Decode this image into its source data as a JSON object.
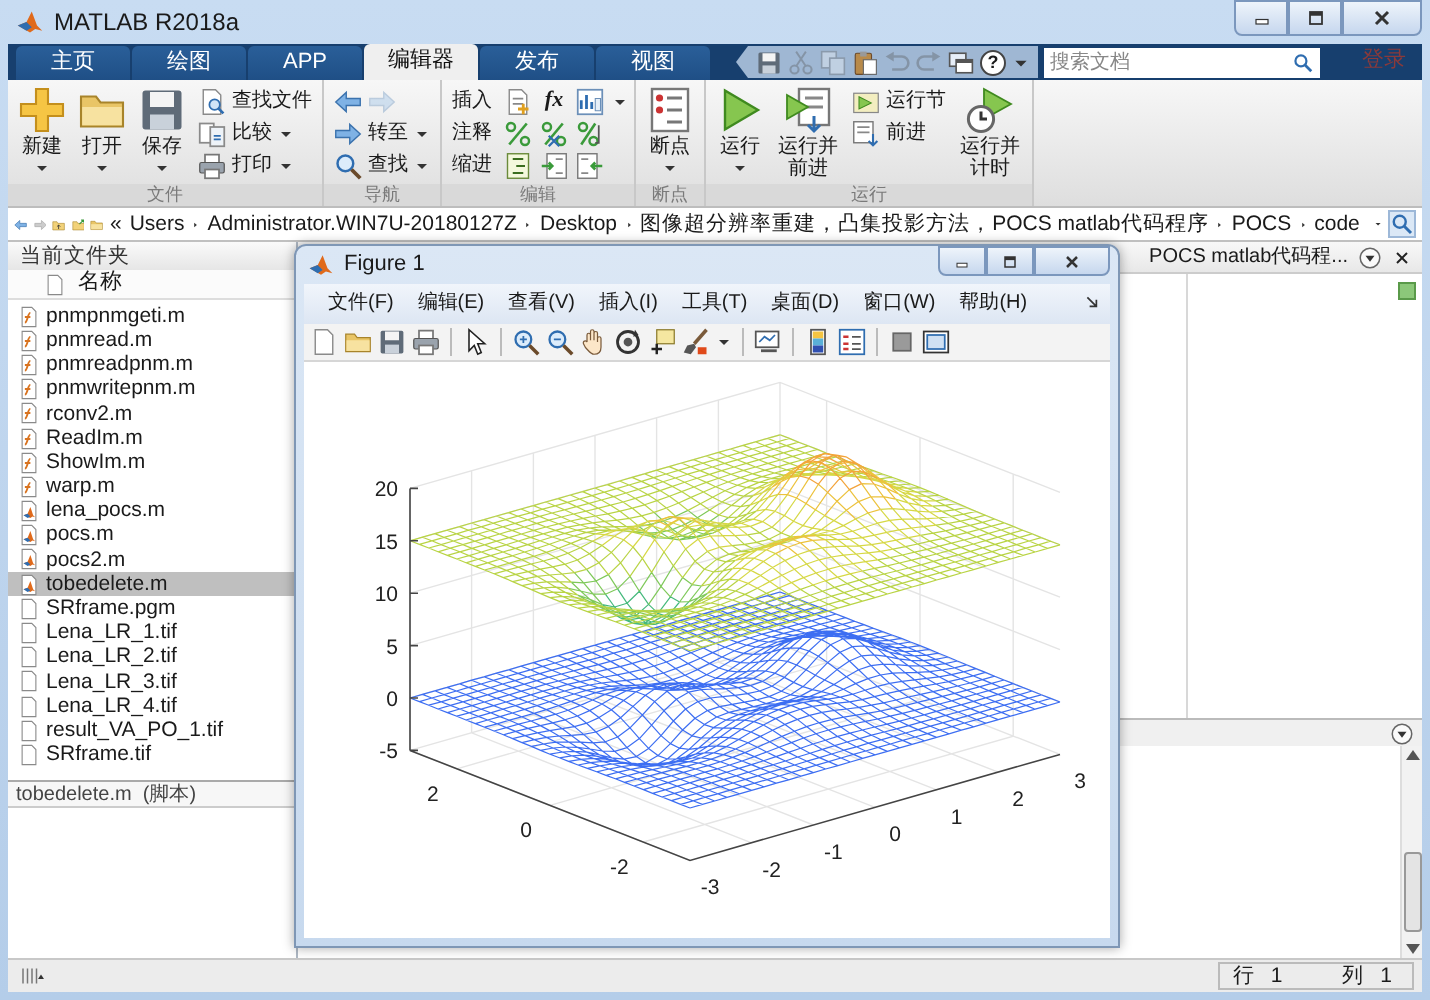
{
  "window": {
    "title": "MATLAB R2018a"
  },
  "tabs": [
    {
      "label": "主页",
      "selected": false
    },
    {
      "label": "绘图",
      "selected": false
    },
    {
      "label": "APP",
      "selected": false
    },
    {
      "label": "编辑器",
      "selected": true
    },
    {
      "label": "发布",
      "selected": false
    },
    {
      "label": "视图",
      "selected": false
    }
  ],
  "quick_access": [
    {
      "kind": "save",
      "disabled": false
    },
    {
      "kind": "cut",
      "disabled": true
    },
    {
      "kind": "copy",
      "disabled": true
    },
    {
      "kind": "paste",
      "disabled": false
    },
    {
      "kind": "undo",
      "disabled": true
    },
    {
      "kind": "redo",
      "disabled": true
    },
    {
      "kind": "windows",
      "disabled": false
    },
    {
      "kind": "help",
      "symbol": "?",
      "disabled": false
    },
    {
      "kind": "menu",
      "disabled": false
    }
  ],
  "search": {
    "placeholder": "搜索文档"
  },
  "sign_in": "登录",
  "ribbon": {
    "groups": [
      {
        "label": "文件",
        "items": [
          {
            "kind": "large",
            "label": "新建",
            "dropdown": true
          },
          {
            "kind": "large",
            "label": "打开",
            "dropdown": true
          },
          {
            "kind": "large",
            "label": "保存",
            "dropdown": true
          },
          {
            "kind": "stack",
            "rows": [
              {
                "kind": "button",
                "label": "查找文件",
                "dropdown": false
              },
              {
                "kind": "button",
                "label": "比较",
                "dropdown": true
              },
              {
                "kind": "button",
                "label": "打印",
                "dropdown": true
              }
            ]
          }
        ]
      },
      {
        "label": "导航",
        "items": [
          {
            "kind": "stack",
            "rows": [
              {
                "kind": "history",
                "back_disabled": false,
                "forward_disabled": true
              },
              {
                "kind": "button",
                "label": "转至",
                "dropdown": true
              },
              {
                "kind": "button",
                "label": "查找",
                "dropdown": true
              }
            ]
          }
        ]
      },
      {
        "label": "编辑",
        "items": [
          {
            "kind": "tools",
            "rows": [
              {
                "label": "插入",
                "symbol": "fx"
              },
              {
                "label": "注释"
              },
              {
                "label": "缩进"
              }
            ]
          }
        ]
      },
      {
        "label": "断点",
        "items": [
          {
            "kind": "large",
            "label": "断点",
            "dropdown": true
          }
        ]
      },
      {
        "label": "运行",
        "items": [
          {
            "kind": "large",
            "label": "运行",
            "dropdown": true
          },
          {
            "kind": "large",
            "label": "运行并前进",
            "dropdown": false
          },
          {
            "kind": "stack",
            "rows": [
              {
                "kind": "button",
                "label": "运行节",
                "dropdown": false
              },
              {
                "kind": "button",
                "label": "前进",
                "dropdown": false
              }
            ]
          },
          {
            "kind": "large",
            "label": "运行并计时",
            "dropdown": false
          }
        ]
      }
    ]
  },
  "address": {
    "overflow": "«",
    "crumbs": [
      "Users",
      "Administrator.WIN7U-20180127Z",
      "Desktop",
      "图像超分辨率重建，凸集投影方法，POCS matlab代码程序",
      "POCS",
      "code"
    ]
  },
  "current_folder": {
    "title": "当前文件夹",
    "column": "名称",
    "files": [
      {
        "name": "pnmpnmgeti.m",
        "kind": "function",
        "selected": false
      },
      {
        "name": "pnmread.m",
        "kind": "function",
        "selected": false
      },
      {
        "name": "pnmreadpnm.m",
        "kind": "function",
        "selected": false
      },
      {
        "name": "pnmwritepnm.m",
        "kind": "function",
        "selected": false
      },
      {
        "name": "rconv2.m",
        "kind": "function",
        "selected": false
      },
      {
        "name": "ReadIm.m",
        "kind": "function",
        "selected": false
      },
      {
        "name": "ShowIm.m",
        "kind": "function",
        "selected": false
      },
      {
        "name": "warp.m",
        "kind": "function",
        "selected": false
      },
      {
        "name": "lena_pocs.m",
        "kind": "script",
        "selected": false
      },
      {
        "name": "pocs.m",
        "kind": "script",
        "selected": false
      },
      {
        "name": "pocs2.m",
        "kind": "script",
        "selected": false
      },
      {
        "name": "tobedelete.m",
        "kind": "script",
        "selected": true
      },
      {
        "name": "SRframe.pgm",
        "kind": "file",
        "selected": false
      },
      {
        "name": "Lena_LR_1.tif",
        "kind": "file",
        "selected": false
      },
      {
        "name": "Lena_LR_2.tif",
        "kind": "file",
        "selected": false
      },
      {
        "name": "Lena_LR_3.tif",
        "kind": "file",
        "selected": false
      },
      {
        "name": "Lena_LR_4.tif",
        "kind": "file",
        "selected": false
      },
      {
        "name": "result_VA_PO_1.tif",
        "kind": "file",
        "selected": false
      },
      {
        "name": "SRframe.tif",
        "kind": "file",
        "selected": false
      }
    ],
    "details": "tobedelete.m  (脚本)"
  },
  "editor": {
    "tab_title": "POCS matlab代码程..."
  },
  "figure": {
    "title": "Figure 1",
    "menu": [
      "文件(F)",
      "编辑(E)",
      "查看(V)",
      "插入(I)",
      "工具(T)",
      "桌面(D)",
      "窗口(W)",
      "帮助(H)"
    ],
    "z_ticks": [
      "20",
      "15",
      "10",
      "5",
      "0",
      "-5"
    ],
    "left_axis_ticks": [
      "2",
      "0",
      "-2"
    ],
    "right_axis_ticks": [
      "-3",
      "-2",
      "-1",
      "0",
      "1",
      "2",
      "3"
    ]
  },
  "status_bar": {
    "line_label": "行",
    "line": "1",
    "column_label": "列",
    "column": "1"
  }
}
